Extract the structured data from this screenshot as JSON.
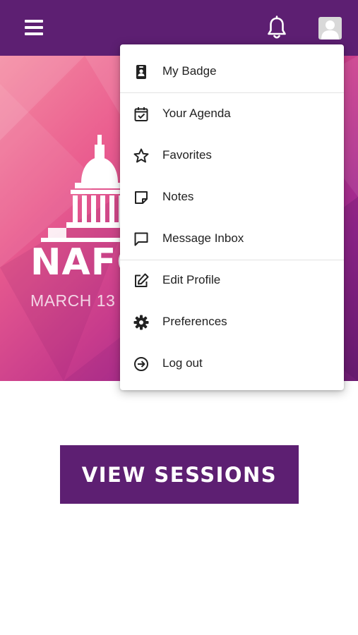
{
  "colors": {
    "brand_purple": "#5d1f72",
    "menu_text": "#222222",
    "hero_gradient": [
      "#f48aa1",
      "#ea5d8f",
      "#c73b8c",
      "#9a2690",
      "#6d1c73"
    ]
  },
  "header": {
    "menu_icon": "hamburger-icon",
    "notifications_icon": "bell-icon",
    "profile_icon": "user-avatar-icon"
  },
  "hero": {
    "title": "NAFC",
    "date": "MARCH 13 -"
  },
  "cta": {
    "label": "VIEW SESSIONS"
  },
  "menu": {
    "items": [
      {
        "label": "My Badge",
        "icon": "badge-icon"
      },
      {
        "label": "Your Agenda",
        "icon": "calendar-check-icon"
      },
      {
        "label": "Favorites",
        "icon": "star-icon"
      },
      {
        "label": "Notes",
        "icon": "note-icon"
      },
      {
        "label": "Message Inbox",
        "icon": "message-icon"
      },
      {
        "label": "Edit Profile",
        "icon": "edit-icon"
      },
      {
        "label": "Preferences",
        "icon": "gear-icon"
      },
      {
        "label": "Log out",
        "icon": "logout-icon"
      }
    ]
  }
}
